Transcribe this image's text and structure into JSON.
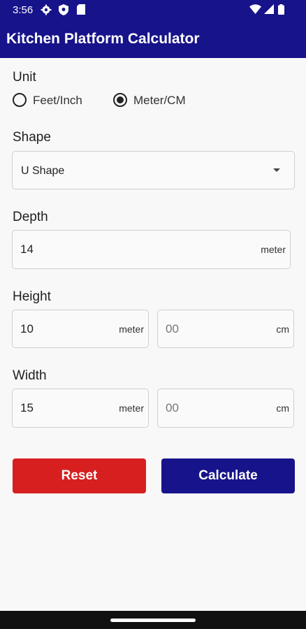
{
  "status_bar": {
    "time": "3:56",
    "left_icons": [
      "gear-icon",
      "shield-icon",
      "sim-card-icon"
    ],
    "right_icons": [
      "wifi-icon",
      "signal-icon",
      "battery-icon"
    ]
  },
  "app_bar": {
    "title": "Kitchen Platform Calculator",
    "color": "#17138a"
  },
  "unit": {
    "label": "Unit",
    "options": [
      {
        "label": "Feet/Inch",
        "selected": false
      },
      {
        "label": "Meter/CM",
        "selected": true
      }
    ]
  },
  "shape": {
    "label": "Shape",
    "selected": "U Shape"
  },
  "depth": {
    "label": "Depth",
    "value": "14",
    "suffix": "meter"
  },
  "height": {
    "label": "Height",
    "meter_value": "10",
    "meter_suffix": "meter",
    "cm_placeholder": "00",
    "cm_suffix": "cm"
  },
  "width": {
    "label": "Width",
    "meter_value": "15",
    "meter_suffix": "meter",
    "cm_placeholder": "00",
    "cm_suffix": "cm"
  },
  "buttons": {
    "reset": {
      "label": "Reset",
      "color": "#d71f1f"
    },
    "calculate": {
      "label": "Calculate",
      "color": "#17138a"
    }
  }
}
